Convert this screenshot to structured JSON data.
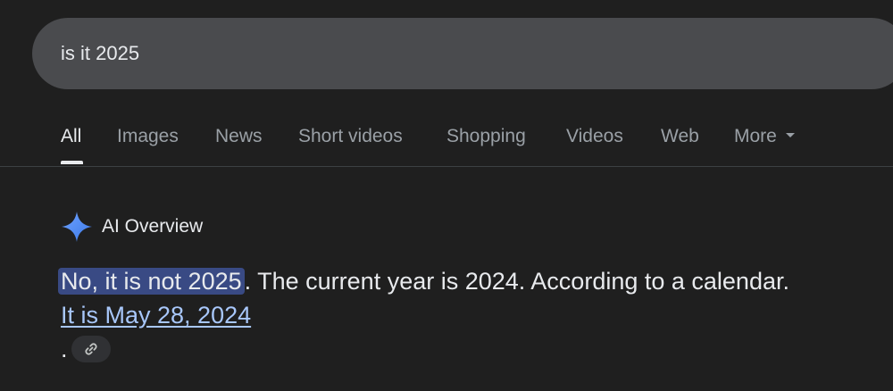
{
  "search": {
    "query": "is it 2025"
  },
  "tabs": [
    {
      "label": "All",
      "active": true
    },
    {
      "label": "Images",
      "active": false
    },
    {
      "label": "News",
      "active": false
    },
    {
      "label": "Short videos",
      "active": false
    },
    {
      "label": "Shopping",
      "active": false
    },
    {
      "label": "Videos",
      "active": false
    },
    {
      "label": "Web",
      "active": false
    },
    {
      "label": "More",
      "active": false
    }
  ],
  "ai_overview": {
    "icon": "sparkle-icon",
    "title": "AI Overview",
    "highlighted_text": "No, it is not 2025",
    "body_text": ". The current year is 2024. According to a calendar.",
    "link_text": "It is May 28, 2024",
    "trailing_text": ".",
    "chip_icon": "link-icon"
  },
  "colors": {
    "background": "#1f1f1f",
    "search_bar": "#4a4b4e",
    "highlight": "#394a84",
    "link": "#a8c7fa",
    "sparkle": "#4f8ef7"
  }
}
